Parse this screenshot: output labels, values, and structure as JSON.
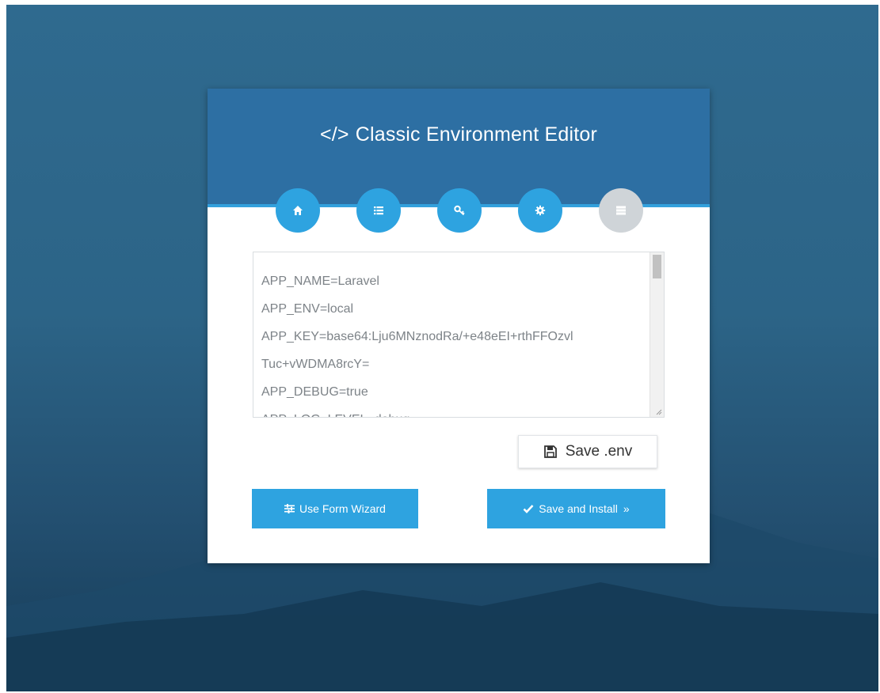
{
  "header": {
    "title_icon": "code-icon",
    "title_glyph": "</>",
    "title": "Classic Environment Editor"
  },
  "steps": [
    {
      "icon": "home-icon",
      "state": "active"
    },
    {
      "icon": "list-icon",
      "state": "active"
    },
    {
      "icon": "key-icon",
      "state": "active"
    },
    {
      "icon": "gear-icon",
      "state": "active"
    },
    {
      "icon": "server-icon",
      "state": "inactive"
    }
  ],
  "editor": {
    "lines": [
      "APP_NAME=Laravel",
      "APP_ENV=local",
      "APP_KEY=base64:Lju6MNznodRa/+e48eEI+rthFFOzvl",
      "Tuc+vWDMA8rcY=",
      "APP_DEBUG=true",
      "APP_LOG_LEVEL=debug"
    ]
  },
  "buttons": {
    "save_env": "Save .env",
    "use_form_wizard": "Use Form Wizard",
    "save_and_install": "Save and Install",
    "install_suffix": "»"
  },
  "colors": {
    "header_blue": "#2d6fa3",
    "accent_blue": "#2ea3e0",
    "inactive_step": "#cfd4d8",
    "background": "#2c6487"
  }
}
